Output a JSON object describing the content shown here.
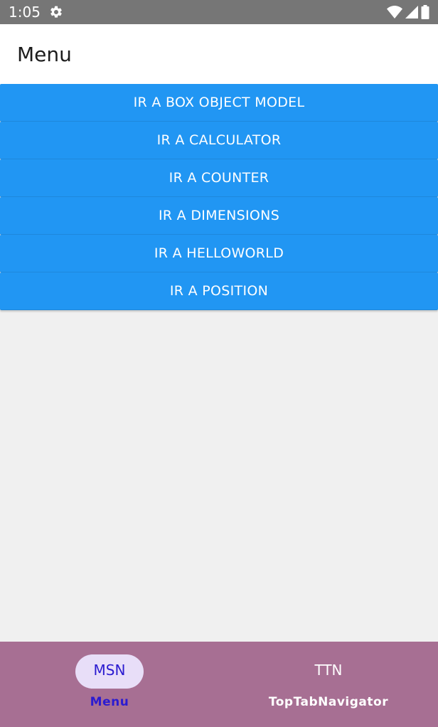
{
  "status_bar": {
    "time": "1:05",
    "icons": [
      "settings-gear-icon",
      "wifi-icon",
      "cell-signal-icon",
      "battery-icon"
    ]
  },
  "app_bar": {
    "title": "Menu"
  },
  "menu": {
    "buttons": [
      {
        "label": "IR A BOX OBJECT MODEL"
      },
      {
        "label": "IR A CALCULATOR"
      },
      {
        "label": "IR A COUNTER"
      },
      {
        "label": "IR A DIMENSIONS"
      },
      {
        "label": "IR A HELLOWORLD"
      },
      {
        "label": "IR A POSITION"
      }
    ]
  },
  "bottom_tabs": {
    "tabs": [
      {
        "icon_text": "MSN",
        "label": "Menu",
        "selected": true
      },
      {
        "icon_text": "TTN",
        "label": "TopTabNavigator",
        "selected": false
      }
    ]
  },
  "colors": {
    "status_bar": "#767676",
    "button": "#2196f3",
    "background": "#f0f0f0",
    "bottom_bar": "#a76f93",
    "active_pill": "#e8def8",
    "active_text": "#2b1bd0"
  }
}
